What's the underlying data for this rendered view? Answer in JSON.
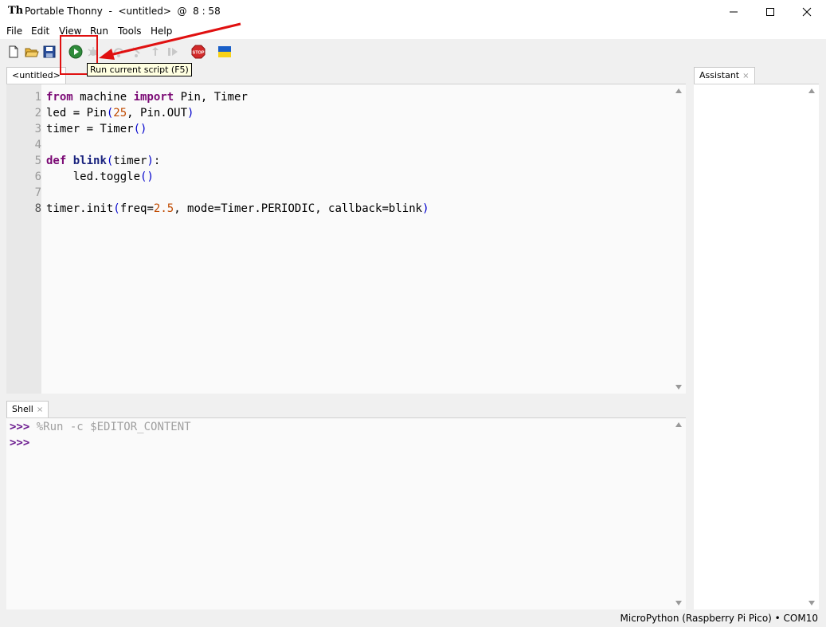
{
  "window": {
    "app_icon_text": "Th",
    "title": "Portable Thonny  -  <untitled>  @  8 : 58",
    "minimize_label": "—",
    "maximize_label": "☐",
    "close_label": "✕"
  },
  "menu": [
    "File",
    "Edit",
    "View",
    "Run",
    "Tools",
    "Help"
  ],
  "toolbar": {
    "tooltip": "Run current script (F5)",
    "stop_label": "STOP",
    "icons": [
      "new-file-icon",
      "open-folder-icon",
      "save-icon",
      "run-icon",
      "debug-icon",
      "step-over-icon",
      "step-into-icon",
      "step-out-icon",
      "resume-icon",
      "stop-icon",
      "ukraine-flag-icon"
    ]
  },
  "editor": {
    "tab_label": "<untitled>",
    "line_numbers": [
      "1",
      "2",
      "3",
      "4",
      "5",
      "6",
      "7",
      "8"
    ],
    "lines": [
      "from machine import Pin, Timer",
      "led = Pin(25, Pin.OUT)",
      "timer = Timer()",
      "",
      "def blink(timer):",
      "    led.toggle()",
      "",
      "timer.init(freq=2.5, mode=Timer.PERIODIC, callback=blink)"
    ]
  },
  "shell": {
    "tab_label": "Shell",
    "close_label": "×",
    "prompt": ">>>",
    "command": "%Run -c $EDITOR_CONTENT"
  },
  "assistant": {
    "tab_label": "Assistant",
    "close_label": "×"
  },
  "status": {
    "text": "MicroPython (Raspberry Pi Pico)  •  COM10"
  },
  "colors": {
    "keyword": "#7a0874",
    "function_name": "#1a237e",
    "number": "#c04a00",
    "prompt": "#6b1b8f",
    "annotation": "#e01010"
  }
}
